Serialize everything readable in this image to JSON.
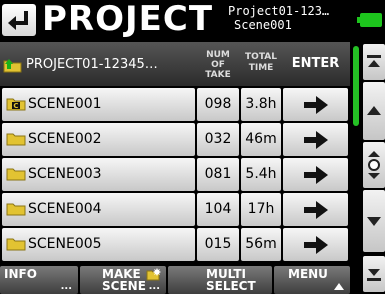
{
  "header": {
    "back_icon": "back-arrow-icon",
    "title": "PROJECT",
    "project_name": "Project01-123",
    "scene_name": "Scene001",
    "ellipsis": "…",
    "battery_icon": "battery-icon",
    "accent_color": "#1dc51d"
  },
  "column_header": {
    "path_icon": "folder-up-icon",
    "path": "PROJECT01-12345",
    "path_ellipsis": "…",
    "take_label_line1": "NUM",
    "take_label_line2": "OF",
    "take_label_line3": "TAKE",
    "time_label_line1": "TOTAL",
    "time_label_line2": "TIME",
    "enter_label": "ENTER"
  },
  "scenes": [
    {
      "name": "SCENE001",
      "takes": "098",
      "time": "3.8h",
      "current": true
    },
    {
      "name": "SCENE002",
      "takes": "032",
      "time": "46m",
      "current": false
    },
    {
      "name": "SCENE003",
      "takes": "081",
      "time": "5.4h",
      "current": false
    },
    {
      "name": "SCENE004",
      "takes": "104",
      "time": "17h",
      "current": false
    },
    {
      "name": "SCENE005",
      "takes": "015",
      "time": "56m",
      "current": false
    }
  ],
  "footer": {
    "info_label": "INFO",
    "make_label_line1": "MAKE",
    "make_label_line2": "SCENE",
    "multi_label_line1": "MULTI",
    "multi_label_line2": "SELECT",
    "menu_label": "MENU",
    "dots": "..."
  },
  "scroll_buttons": [
    "scroll-top-icon",
    "page-up-icon",
    "scroll-position-icon",
    "page-down-icon",
    "scroll-bottom-icon"
  ]
}
